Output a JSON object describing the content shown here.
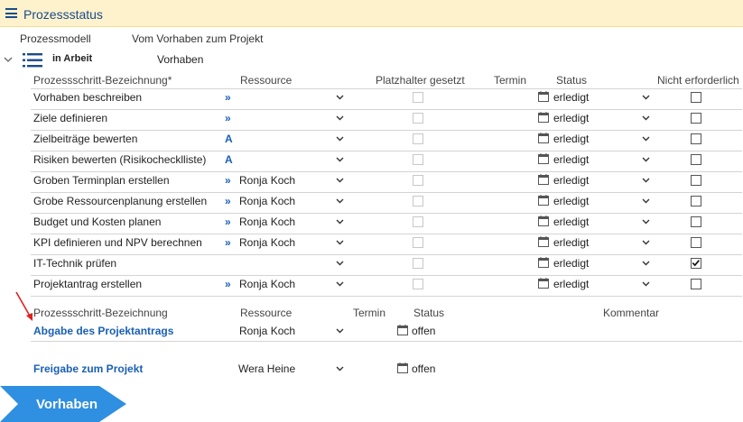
{
  "header": {
    "title": "Prozessstatus"
  },
  "model": {
    "label": "Prozessmodell",
    "value": "Vom Vorhaben zum Projekt"
  },
  "phase": {
    "state": "in Arbeit",
    "name": "Vorhaben"
  },
  "table1": {
    "columns": [
      "Prozessschritt-Bezeichnung*",
      "Ressource",
      "Platzhalter gesetzt",
      "Termin",
      "Status",
      "Nicht erforderlich"
    ],
    "rows": [
      {
        "name": "Vorhaben beschreiben",
        "res_link": "»",
        "res_name": "",
        "status": "erledigt",
        "not_required": false
      },
      {
        "name": "Ziele definieren",
        "res_link": "»",
        "res_name": "",
        "status": "erledigt",
        "not_required": false
      },
      {
        "name": "Zielbeiträge bewerten",
        "res_link": "A",
        "res_name": "",
        "status": "erledigt",
        "not_required": false
      },
      {
        "name": "Risiken bewerten (Risikochecklliste)",
        "res_link": "A",
        "res_name": "",
        "status": "erledigt",
        "not_required": false
      },
      {
        "name": "Groben Terminplan erstellen",
        "res_link": "»",
        "res_name": "Ronja Koch",
        "status": "erledigt",
        "not_required": false
      },
      {
        "name": "Grobe Ressourcenplanung erstellen",
        "res_link": "»",
        "res_name": "Ronja Koch",
        "status": "erledigt",
        "not_required": false
      },
      {
        "name": "Budget und Kosten planen",
        "res_link": "»",
        "res_name": "Ronja Koch",
        "status": "erledigt",
        "not_required": false
      },
      {
        "name": "KPI definieren und NPV berechnen",
        "res_link": "»",
        "res_name": "Ronja Koch",
        "status": "erledigt",
        "not_required": false
      },
      {
        "name": "IT-Technik prüfen",
        "res_link": "",
        "res_name": "",
        "status": "erledigt",
        "not_required": true
      },
      {
        "name": "Projektantrag erstellen",
        "res_link": "»",
        "res_name": "Ronja Koch",
        "status": "erledigt",
        "not_required": false
      }
    ]
  },
  "table2": {
    "columns": [
      "Prozessschritt-Bezeichnung",
      "Ressource",
      "Termin",
      "Status",
      "Kommentar"
    ],
    "rows": [
      {
        "name": "Abgabe des Projektantrags",
        "res_name": "Ronja Koch",
        "status": "offen"
      }
    ]
  },
  "release": {
    "name": "Freigabe zum Projekt",
    "res_name": "Wera Heine",
    "status": "offen"
  },
  "phase_button": {
    "label": "Vorhaben"
  },
  "colors": {
    "accent": "#1a5fb4",
    "header_bg": "#fdf2cc",
    "chevron_bg": "#2f8fe0",
    "arrow": "#e02020"
  }
}
